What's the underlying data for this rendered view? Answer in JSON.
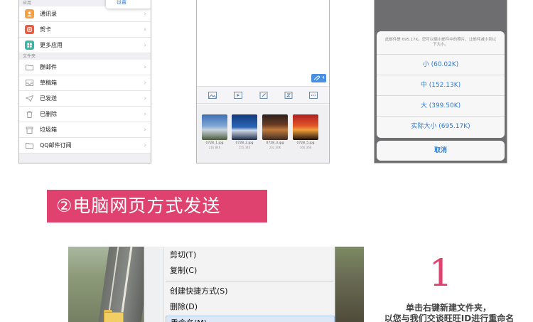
{
  "phone_mail_list": {
    "settings_popup": "设置",
    "sections": [
      {
        "header": "应用",
        "items": [
          {
            "label": "通讯录",
            "icon": "contacts-icon",
            "color": "#f7a040"
          },
          {
            "label": "贺卡",
            "icon": "greeting-card-icon",
            "color": "#ee5a3e"
          },
          {
            "label": "更多应用",
            "icon": "more-apps-icon",
            "color": "#35b8a6"
          }
        ]
      },
      {
        "header": "文件夹",
        "items": [
          {
            "label": "群邮件",
            "icon": "folder-icon"
          },
          {
            "label": "草稿箱",
            "icon": "drafts-icon"
          },
          {
            "label": "已发送",
            "icon": "sent-icon"
          },
          {
            "label": "已删除",
            "icon": "trash-icon"
          },
          {
            "label": "垃圾箱",
            "icon": "spam-icon"
          },
          {
            "label": "QQ邮件订阅",
            "icon": "folder-icon"
          }
        ]
      }
    ],
    "chevron": "›"
  },
  "phone_compose": {
    "attachment_count": "4",
    "toolbar_icons": [
      "image-icon",
      "video-icon",
      "edit-icon",
      "doc-icon",
      "more-icon"
    ],
    "thumbnails": [
      {
        "name": "0728_1.jpg",
        "size": "216.84K"
      },
      {
        "name": "0728_2.jpg",
        "size": "155.34K"
      },
      {
        "name": "0728_3.jpg",
        "size": "232.30K"
      },
      {
        "name": "0728_5.jpg",
        "size": "166.36K"
      }
    ]
  },
  "phone_size_sheet": {
    "message": "此邮件是 695.17K。您可以缩小邮件中的照片，让邮件减小到以下大小。",
    "options": [
      "小 (60.02K)",
      "中 (152.13K)",
      "大 (399.50K)",
      "实际大小 (695.17K)"
    ],
    "cancel": "取消"
  },
  "banner": {
    "text": "②电脑网页方式发送",
    "color": "#e0426f"
  },
  "context_menu": {
    "items": [
      "剪切(T)",
      "复制(C)",
      "创建快捷方式(S)",
      "删除(D)",
      "重命名(M)"
    ]
  },
  "step": {
    "number": "1",
    "line1": "单击右键新建文件夹，",
    "line2": "以您与我们交谈旺旺ID进行重命名"
  }
}
